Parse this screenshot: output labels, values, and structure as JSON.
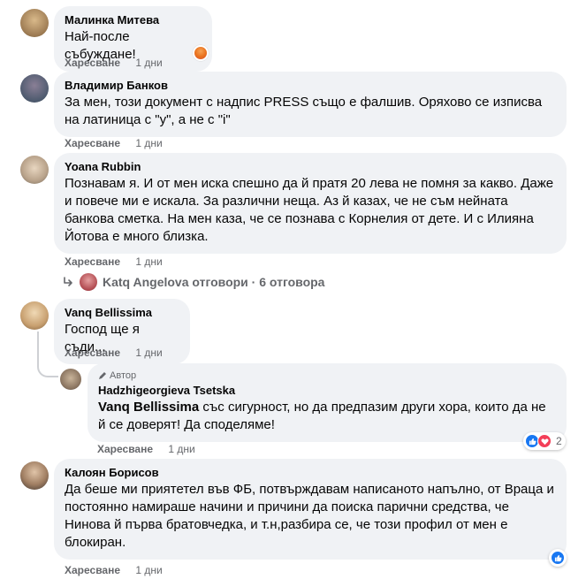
{
  "comments": [
    {
      "author": "Малинка Митева",
      "text": "Най-после събуждане!",
      "like_label": "Харесване",
      "time": "1 дни",
      "avatar_icon": "user-avatar-icon"
    },
    {
      "author": "Владимир Банков",
      "text": "За мен, този документ с надпис PRESS също е фалшив. Оряхово се изписва на латиница с \"у\", а не с \"i\"",
      "like_label": "Харесване",
      "time": "1 дни",
      "avatar_icon": "user-avatar-icon"
    },
    {
      "author": "Yoana Rubbin",
      "text": "Познавам я. И от мен иска спешно да й пратя 20 лева не помня за какво. Даже и повече ми е искала. За различни неща. Аз й казах, че не съм нейната банкова сметка. На мен каза, че се познава с Корнелия от дете. И с Илияна Йотова е много близка.",
      "like_label": "Харесване",
      "time": "1 дни",
      "replies_link": "Katq Angelova отговори · 6 отговора",
      "avatar_icon": "user-avatar-icon"
    },
    {
      "author": "Vanq Bellissima",
      "text": "Господ ще я съди...",
      "like_label": "Харесване",
      "time": "1 дни",
      "avatar_icon": "user-avatar-icon"
    },
    {
      "author": "Калоян Борисов",
      "text": "Да беше ми приятетел във ФБ, потвърждавам написаното напълно, от Враца и постоянно намираше начини и причини да поиска парични средства, че Нинова й първа братовчедка, и т.н,разбира се, че този профил от мен е блокиран.",
      "like_label": "Харесване",
      "time": "1 дни",
      "avatar_icon": "user-avatar-icon"
    }
  ],
  "reply": {
    "badge": "Автор",
    "author": "Hadzhigeorgieva Tsetska",
    "mention": "Vanq Bellissima",
    "text": " със сигурност, но да предпазим други хора, които да не й се доверят! Да споделяме!",
    "like_label": "Харесване",
    "time": "1 дни",
    "reaction_count": "2"
  },
  "colors": {
    "bubble": "#f0f2f5",
    "meta": "#65676b",
    "like_blue": "#1877f2",
    "love_red": "#f33e58",
    "angry_orange": "#e9711c"
  }
}
